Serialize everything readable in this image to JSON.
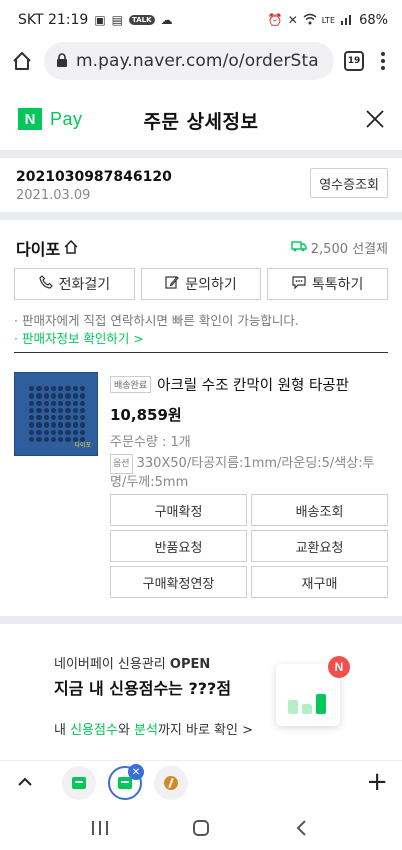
{
  "status_bar": {
    "carrier_time": "SKT 21:19",
    "talk_badge": "TALK",
    "battery": "68%",
    "lte": "LTE"
  },
  "browser": {
    "url": "m.pay.naver.com/o/orderSta",
    "tab_count": "19"
  },
  "header": {
    "logo_letter": "N",
    "logo_text": "Pay",
    "title": "주문 상세정보"
  },
  "order": {
    "number": "2021030987846120",
    "date": "2021.03.09",
    "receipt_label": "영수증조회"
  },
  "seller": {
    "name": "다이포",
    "shipping_fee": "2,500 선결제",
    "buttons": {
      "call": "전화걸기",
      "inquiry": "문의하기",
      "talk": "톡톡하기"
    },
    "notice": "· 판매자에게 직접 연락하시면 빠른 확인이 가능합니다.",
    "info_link": "· 판매자정보 확인하기 >"
  },
  "product": {
    "status_tag": "배송완료",
    "name": "아크릴 수조 칸막이 원형 타공판",
    "price": "10,859원",
    "quantity": "주문수량 : 1개",
    "option_tag": "옵션",
    "option_text": "330X50/타공지름:1mm/라운딩:5/색상:투명/두께:5mm",
    "thumb_label": "다이포"
  },
  "actions": [
    "구매확정",
    "배송조회",
    "반품요청",
    "교환요청",
    "구매확정연장",
    "재구매"
  ],
  "banner": {
    "sub_prefix": "네이버페이 신용관리 ",
    "sub_bold": "OPEN",
    "title": "지금 내 신용점수는 ???점",
    "link_prefix": "내 ",
    "link_green1": "신용점수",
    "link_mid": "와 ",
    "link_green2": "분석",
    "link_suffix": "까지 바로 확인 >",
    "badge": "N"
  },
  "bottom_tabs": {
    "plus": "+"
  },
  "colors": {
    "brand_green": "#03c75a",
    "active_tab_blue": "#3b6fd8",
    "badge_red": "#f24e4e"
  }
}
